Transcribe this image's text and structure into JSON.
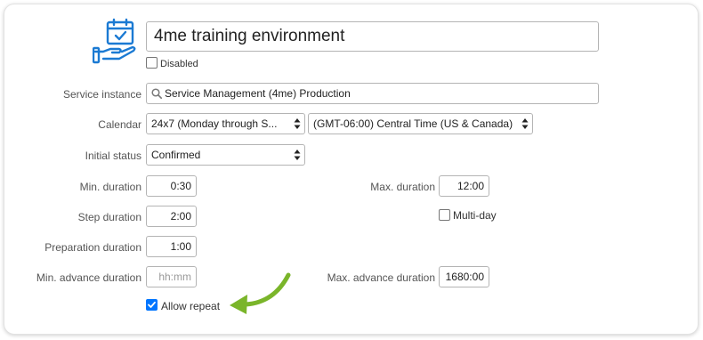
{
  "form": {
    "title_value": "4me training environment",
    "disabled_label": "Disabled",
    "service_instance": {
      "label": "Service instance",
      "value": "Service Management (4me) Production"
    },
    "calendar": {
      "label": "Calendar",
      "value": "24x7 (Monday through S...",
      "timezone": "(GMT-06:00) Central Time (US & Canada)"
    },
    "initial_status": {
      "label": "Initial status",
      "value": "Confirmed"
    },
    "min_duration": {
      "label": "Min. duration",
      "value": "0:30"
    },
    "max_duration": {
      "label": "Max. duration",
      "value": "12:00"
    },
    "step_duration": {
      "label": "Step duration",
      "value": "2:00"
    },
    "multi_day_label": "Multi-day",
    "preparation_duration": {
      "label": "Preparation duration",
      "value": "1:00"
    },
    "min_advance_duration": {
      "label": "Min. advance duration",
      "placeholder": "hh:mm"
    },
    "max_advance_duration": {
      "label": "Max. advance duration",
      "value": "1680:00"
    },
    "allow_repeat_label": "Allow repeat"
  },
  "icons": {
    "service_icon": "calendar-hand-icon",
    "search_icon": "search-icon",
    "select_arrows": "updown-arrows-icon",
    "annotation": "curved-arrow-icon"
  },
  "colors": {
    "icon_blue": "#1b7ad3",
    "checkbox_blue": "#0075ff",
    "arrow_green": "#7ab52a"
  }
}
